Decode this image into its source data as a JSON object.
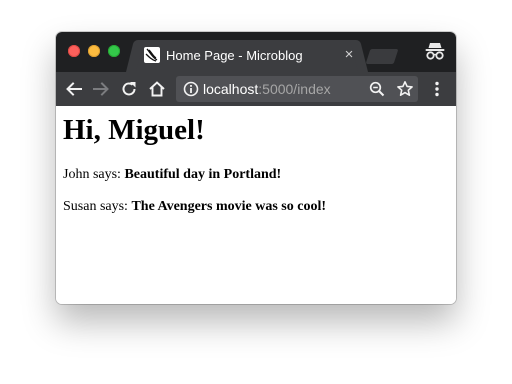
{
  "browser": {
    "tab": {
      "title": "Home Page - Microblog",
      "close_glyph": "×",
      "favicon": "flask-favicon-icon"
    },
    "address_bar": {
      "host": "localhost",
      "path": ":5000/index"
    },
    "icons": {
      "back": "back-arrow-icon",
      "forward": "forward-arrow-icon",
      "reload": "reload-icon",
      "home": "home-icon",
      "info": "info-icon",
      "zoom": "zoom-out-icon",
      "bookmark": "star-icon",
      "menu": "kebab-menu-icon",
      "incognito": "incognito-icon"
    },
    "colors": {
      "titlebar": "#1f2022",
      "toolbar": "#3c3d40",
      "omnibox": "#505155",
      "close_red": "#fc605c",
      "minimize_yellow": "#fdbc40",
      "zoom_green": "#34c84a"
    }
  },
  "page": {
    "heading": "Hi, Miguel!",
    "posts": [
      {
        "author_says": "John says:",
        "body": "Beautiful day in Portland!"
      },
      {
        "author_says": "Susan says:",
        "body": "The Avengers movie was so cool!"
      }
    ]
  }
}
